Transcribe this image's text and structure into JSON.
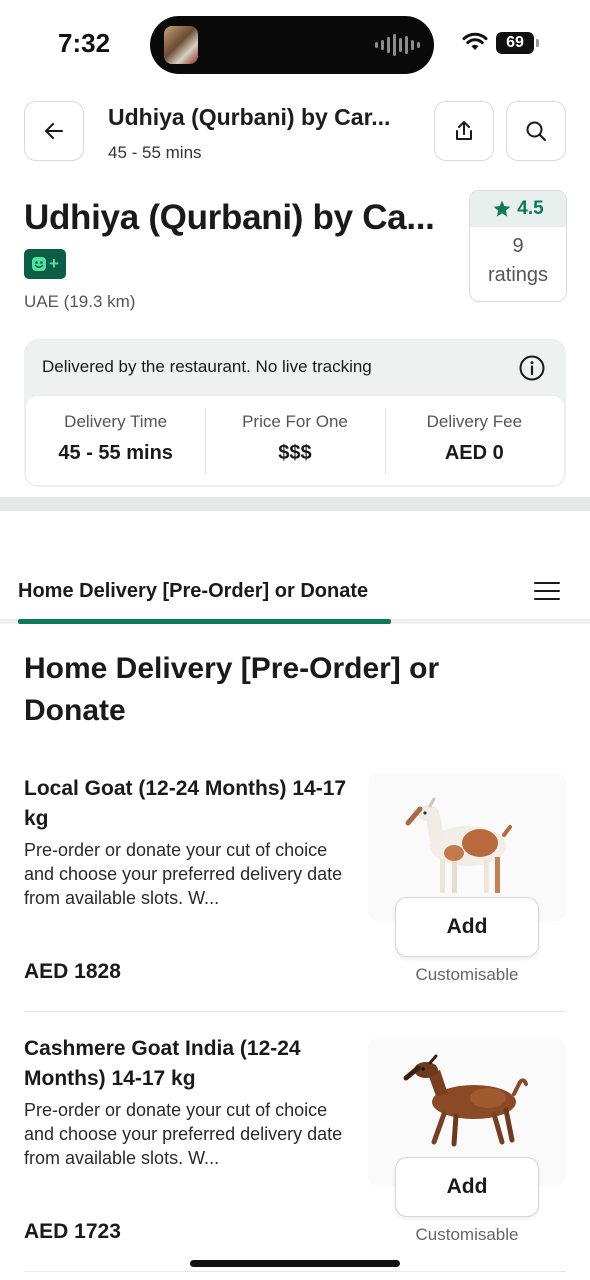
{
  "status_bar": {
    "time": "7:32",
    "battery": "69"
  },
  "header": {
    "title": "Udhiya (Qurbani) by Car...",
    "subtitle": "45 - 55 mins"
  },
  "restaurant": {
    "name": "Udhiya (Qurbani) by Ca...",
    "location": "UAE (19.3 km)",
    "badge": "+",
    "rating": {
      "value": "4.5",
      "count": "9",
      "label": "ratings"
    }
  },
  "delivery": {
    "note": "Delivered by the restaurant. No live tracking",
    "stats": [
      {
        "label": "Delivery Time",
        "value": "45 - 55 mins"
      },
      {
        "label": "Price For One",
        "value": "$$$"
      },
      {
        "label": "Delivery Fee",
        "value": "AED 0"
      }
    ]
  },
  "tab": {
    "label": "Home Delivery [Pre-Order] or Donate"
  },
  "section": {
    "title": "Home Delivery [Pre-Order] or Donate"
  },
  "items": [
    {
      "name": "Local Goat (12-24 Months) 14-17 kg",
      "description": "Pre-order or donate your cut of choice and choose your preferred delivery date from available slots. W...",
      "price": "AED 1828",
      "add_label": "Add",
      "note": "Customisable"
    },
    {
      "name": "Cashmere Goat India (12-24 Months) 14-17 kg",
      "description": "Pre-order or donate your cut of choice and choose your preferred delivery date from available slots. W...",
      "price": "AED 1723",
      "add_label": "Add",
      "note": "Customisable"
    }
  ],
  "colors": {
    "accent": "#0d7a5a",
    "badge_bg": "#0b5d45",
    "card_bg": "#eef1ef"
  }
}
